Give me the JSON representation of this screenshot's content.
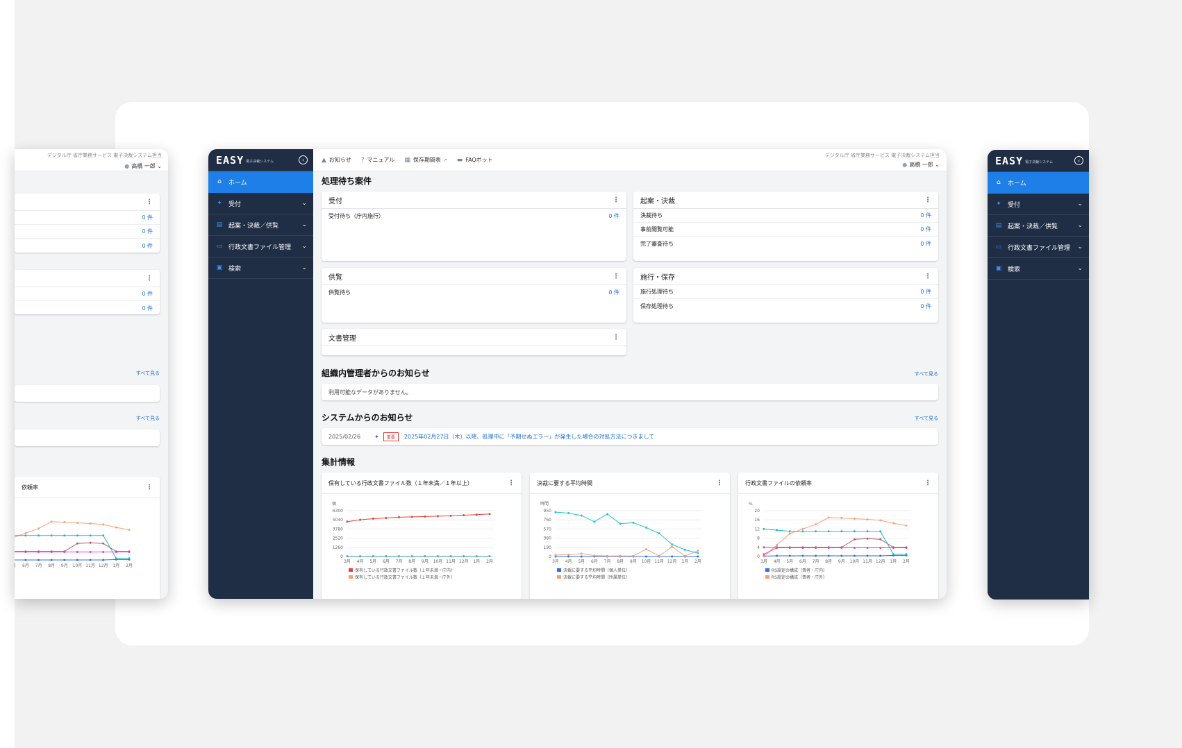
{
  "brand": {
    "logo": "EASY",
    "subtitle": "電子決裁システム"
  },
  "org": "デジタル庁 省庁業務サービス 電子決裁システム担当",
  "user": {
    "name": "高橋 一郎"
  },
  "header": {
    "items": [
      {
        "label": "お知らせ",
        "icon": "bell-icon"
      },
      {
        "label": "マニュアル",
        "icon": "help-circle-icon"
      },
      {
        "label": "保存期間表",
        "icon": "table-icon"
      },
      {
        "label": "FAQボット",
        "icon": "chat-icon"
      }
    ]
  },
  "sidebar": {
    "items": [
      {
        "label": "ホーム",
        "icon": "home-icon",
        "active": true
      },
      {
        "label": "受付",
        "icon": "pin-icon"
      },
      {
        "label": "起案・決裁／供覧",
        "icon": "document-icon"
      },
      {
        "label": "行政文書ファイル管理",
        "icon": "folder-icon"
      },
      {
        "label": "検索",
        "icon": "search-doc-icon"
      }
    ]
  },
  "pending": {
    "title": "処理待ち案件",
    "panels": {
      "reception": {
        "title": "受付",
        "rows": [
          {
            "label": "受付待ち（庁内施行）",
            "count": "0 件"
          }
        ]
      },
      "approval": {
        "title": "起案・決裁",
        "rows": [
          {
            "label": "決裁待ち",
            "count": "0 件"
          },
          {
            "label": "事前閲覧可能",
            "count": "0 件"
          },
          {
            "label": "完了審査待ち",
            "count": "0 件"
          }
        ]
      },
      "circulation": {
        "title": "供覧",
        "rows": [
          {
            "label": "供覧待ち",
            "count": "0 件"
          }
        ]
      },
      "enforcement": {
        "title": "施行・保存",
        "rows": [
          {
            "label": "施行処理待ち",
            "count": "0 件"
          },
          {
            "label": "保存処理待ち",
            "count": "0 件"
          }
        ]
      },
      "documents": {
        "title": "文書管理"
      }
    }
  },
  "org_notice": {
    "title": "組織内管理者からのお知らせ",
    "see_all": "すべて見る",
    "empty": "利用可能なデータがありません。"
  },
  "system_notice": {
    "title": "システムからのお知らせ",
    "see_all": "すべて見る",
    "items": [
      {
        "date": "2025/02/26",
        "badge": "重要",
        "text": "2025年02月27日（木）以降、処理中に「予期せぬエラー」が発生した場合の対処方法につきまして"
      }
    ]
  },
  "stats": {
    "title": "集計情報"
  },
  "colors": {
    "sidebar": "#1f2d45",
    "accent": "#1e7fe8",
    "link": "#1e6fd6",
    "badge": "#e53935"
  },
  "chart_data": [
    {
      "type": "line",
      "title": "保有している行政文書ファイル数（１年未満／１年以上）",
      "ylabel": "個",
      "categories": [
        "3月",
        "4月",
        "5月",
        "6月",
        "7月",
        "8月",
        "9月",
        "10月",
        "11月",
        "12月",
        "1月",
        "2月"
      ],
      "ylim": [
        0,
        6300
      ],
      "yticks": [
        0,
        1260,
        2520,
        3780,
        5040,
        6300
      ],
      "series": [
        {
          "name": "保有している行政文書ファイル数（１年未満・庁内）",
          "color": "#e0443a",
          "values": [
            4800,
            5050,
            5200,
            5300,
            5400,
            5450,
            5500,
            5550,
            5600,
            5680,
            5750,
            5850
          ]
        },
        {
          "name": "保有している行政文書ファイル数（１年未満・庁外）",
          "color": "#f4a07a",
          "values": [
            20,
            20,
            20,
            20,
            20,
            20,
            20,
            20,
            20,
            20,
            20,
            20
          ]
        },
        {
          "name": "",
          "color": "#3ab3b8",
          "values": [
            30,
            30,
            30,
            30,
            30,
            30,
            30,
            30,
            30,
            30,
            30,
            30
          ]
        }
      ]
    },
    {
      "type": "line",
      "title": "決裁に要する平均時間",
      "ylabel": "時間",
      "categories": [
        "3月",
        "4月",
        "5月",
        "6月",
        "7月",
        "8月",
        "9月",
        "10月",
        "11月",
        "12月",
        "1月",
        "2月"
      ],
      "ylim": [
        0,
        950
      ],
      "yticks": [
        0,
        190,
        380,
        570,
        760,
        950
      ],
      "series": [
        {
          "name": "決裁に要する平均時間（個人単位）",
          "color": "#2f6fe0",
          "values": [
            0,
            0,
            0,
            0,
            0,
            0,
            0,
            0,
            0,
            0,
            0,
            0
          ]
        },
        {
          "name": "決裁に要する平均時間（所属単位）",
          "color": "#f4a07a",
          "values": [
            30,
            40,
            60,
            20,
            10,
            10,
            10,
            150,
            10,
            200,
            10,
            120
          ]
        },
        {
          "name": "",
          "color": "#20c4d0",
          "values": [
            920,
            900,
            850,
            720,
            880,
            680,
            700,
            600,
            480,
            250,
            140,
            70
          ]
        }
      ]
    },
    {
      "type": "line",
      "title": "行政文書ファイルの依頼率",
      "ylabel": "%",
      "categories": [
        "3月",
        "4月",
        "5月",
        "6月",
        "7月",
        "8月",
        "9月",
        "10月",
        "11月",
        "12月",
        "1月",
        "2月"
      ],
      "ylim": [
        0,
        20
      ],
      "yticks": [
        0,
        4,
        8,
        12,
        16,
        20
      ],
      "series": [
        {
          "name": "RS設定の構成（責者・庁内）",
          "color": "#2f6fe0",
          "values": [
            0.2,
            0.3,
            0.3,
            0.3,
            0.3,
            0.3,
            0.3,
            0.3,
            0.3,
            0.3,
            0.5,
            0.5
          ]
        },
        {
          "name": "RS設定の構成（責者・庁外）",
          "color": "#f4a07a",
          "values": [
            0,
            5,
            10,
            12,
            14,
            17,
            16.8,
            16.5,
            16.2,
            15.8,
            14.5,
            13.5
          ]
        },
        {
          "name": "",
          "color": "#20b8c8",
          "values": [
            12,
            11.5,
            11,
            11,
            11,
            11,
            11,
            11,
            11,
            11,
            1,
            1
          ]
        },
        {
          "name": "",
          "color": "#b05a6a",
          "values": [
            4,
            4,
            4,
            4,
            4,
            4,
            4,
            7.5,
            7.8,
            7.5,
            4,
            4
          ]
        },
        {
          "name": "",
          "color": "#e040c8",
          "values": [
            1,
            3.8,
            3.8,
            3.8,
            3.8,
            3.8,
            3.8,
            3.8,
            3.8,
            3.8,
            3.8,
            3.8
          ]
        }
      ]
    }
  ]
}
